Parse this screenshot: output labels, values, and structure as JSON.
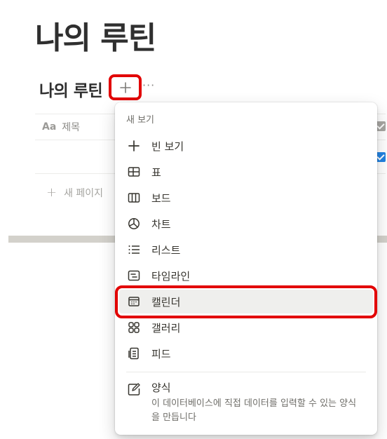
{
  "page": {
    "title": "나의 루틴"
  },
  "database": {
    "title": "나의 루틴",
    "more_label": "···",
    "title_column_icon": "Aa",
    "title_column": "제목",
    "new_page_icon": "+",
    "new_page": "새 페이지"
  },
  "menu": {
    "header": "새 보기",
    "items": [
      {
        "label": "빈 보기",
        "icon": "plus-icon"
      },
      {
        "label": "표",
        "icon": "table-icon"
      },
      {
        "label": "보드",
        "icon": "board-icon"
      },
      {
        "label": "차트",
        "icon": "chart-icon"
      },
      {
        "label": "리스트",
        "icon": "list-icon"
      },
      {
        "label": "타임라인",
        "icon": "timeline-icon"
      },
      {
        "label": "캘린더",
        "icon": "calendar-icon",
        "highlighted": true
      },
      {
        "label": "갤러리",
        "icon": "gallery-icon"
      },
      {
        "label": "피드",
        "icon": "feed-icon"
      }
    ],
    "template": {
      "label": "양식",
      "icon": "form-icon",
      "description": "이 데이터베이스에 직접 데이터를 입력할 수 있는 양식을 만듭니다"
    }
  },
  "colors": {
    "highlight_ring": "#e20000",
    "checkbox_blue": "#2383e2",
    "text": "#37352f",
    "muted": "#6f6e69"
  }
}
